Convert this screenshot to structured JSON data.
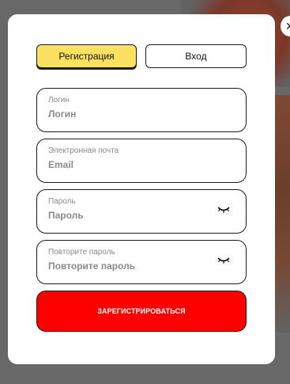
{
  "tabs": {
    "register_label": "Регистрация",
    "login_label": "Вход"
  },
  "fields": {
    "login": {
      "label": "Логин",
      "placeholder": "Логин"
    },
    "email": {
      "label": "Электронная почта",
      "placeholder": "Email"
    },
    "password": {
      "label": "Пароль",
      "placeholder": "Пароль"
    },
    "password_repeat": {
      "label": "Повторите пароль",
      "placeholder": "Повторите пароль"
    }
  },
  "submit_label": "ЗАРЕГИСТРИРОВАТЬСЯ",
  "close_icon": "close-icon",
  "colors": {
    "accent_yellow": "#fbe160",
    "submit_red": "#ff0000"
  }
}
